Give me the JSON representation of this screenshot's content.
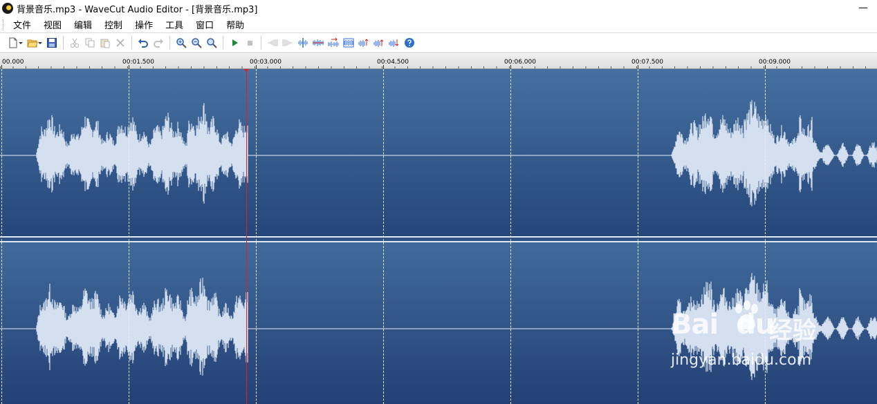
{
  "window": {
    "title": "背景音乐.mp3 - WaveCut Audio Editor - [背景音乐.mp3]",
    "app_icon": "wavecut-logo-icon"
  },
  "menu": {
    "items": [
      "文件",
      "视图",
      "编辑",
      "控制",
      "操作",
      "工具",
      "窗口",
      "帮助"
    ]
  },
  "toolbar": {
    "buttons": [
      {
        "icon": "new-file-icon",
        "enabled": true
      },
      {
        "icon": "open-folder-icon",
        "enabled": true
      },
      {
        "icon": "save-icon",
        "enabled": true
      },
      {
        "icon": "cut-icon",
        "enabled": false
      },
      {
        "icon": "copy-icon",
        "enabled": false
      },
      {
        "icon": "paste-icon",
        "enabled": false
      },
      {
        "icon": "delete-icon",
        "enabled": false
      },
      {
        "icon": "undo-icon",
        "enabled": true
      },
      {
        "icon": "redo-icon",
        "enabled": false
      },
      {
        "icon": "zoom-in-icon",
        "enabled": true
      },
      {
        "icon": "zoom-out-icon",
        "enabled": true
      },
      {
        "icon": "zoom-fit-icon",
        "enabled": true
      },
      {
        "icon": "play-icon",
        "enabled": true
      },
      {
        "icon": "stop-icon",
        "enabled": false
      },
      {
        "icon": "fade-in-icon",
        "enabled": false
      },
      {
        "icon": "fade-out-icon",
        "enabled": false
      },
      {
        "icon": "split-icon",
        "enabled": true
      },
      {
        "icon": "trim-icon",
        "enabled": true
      },
      {
        "icon": "reverse-icon",
        "enabled": true
      },
      {
        "icon": "normalize-icon",
        "enabled": true
      },
      {
        "icon": "amplify-icon",
        "enabled": true
      },
      {
        "icon": "volume-up-icon",
        "enabled": true
      },
      {
        "icon": "volume-down-icon",
        "enabled": true
      },
      {
        "icon": "help-icon",
        "enabled": true
      }
    ]
  },
  "ruler": {
    "labels": [
      "00.000",
      "00:01.500",
      "00:03.000",
      "00:04.500",
      "00:06.000",
      "00:07.500",
      "00:09.000"
    ]
  },
  "playback": {
    "playhead_time": "00:02.920"
  },
  "channels": [
    {
      "name": "left-channel"
    },
    {
      "name": "right-channel"
    }
  ],
  "colors": {
    "wave_bg_top": "#4670a0",
    "wave_bg_bottom": "#25467a",
    "waveform": "#d4e0ef",
    "playhead": "#e02020"
  },
  "watermark": {
    "brand": "Bai",
    "brand_suffix": "du",
    "cn": "经验",
    "url": "jingyan.baidu.com"
  }
}
